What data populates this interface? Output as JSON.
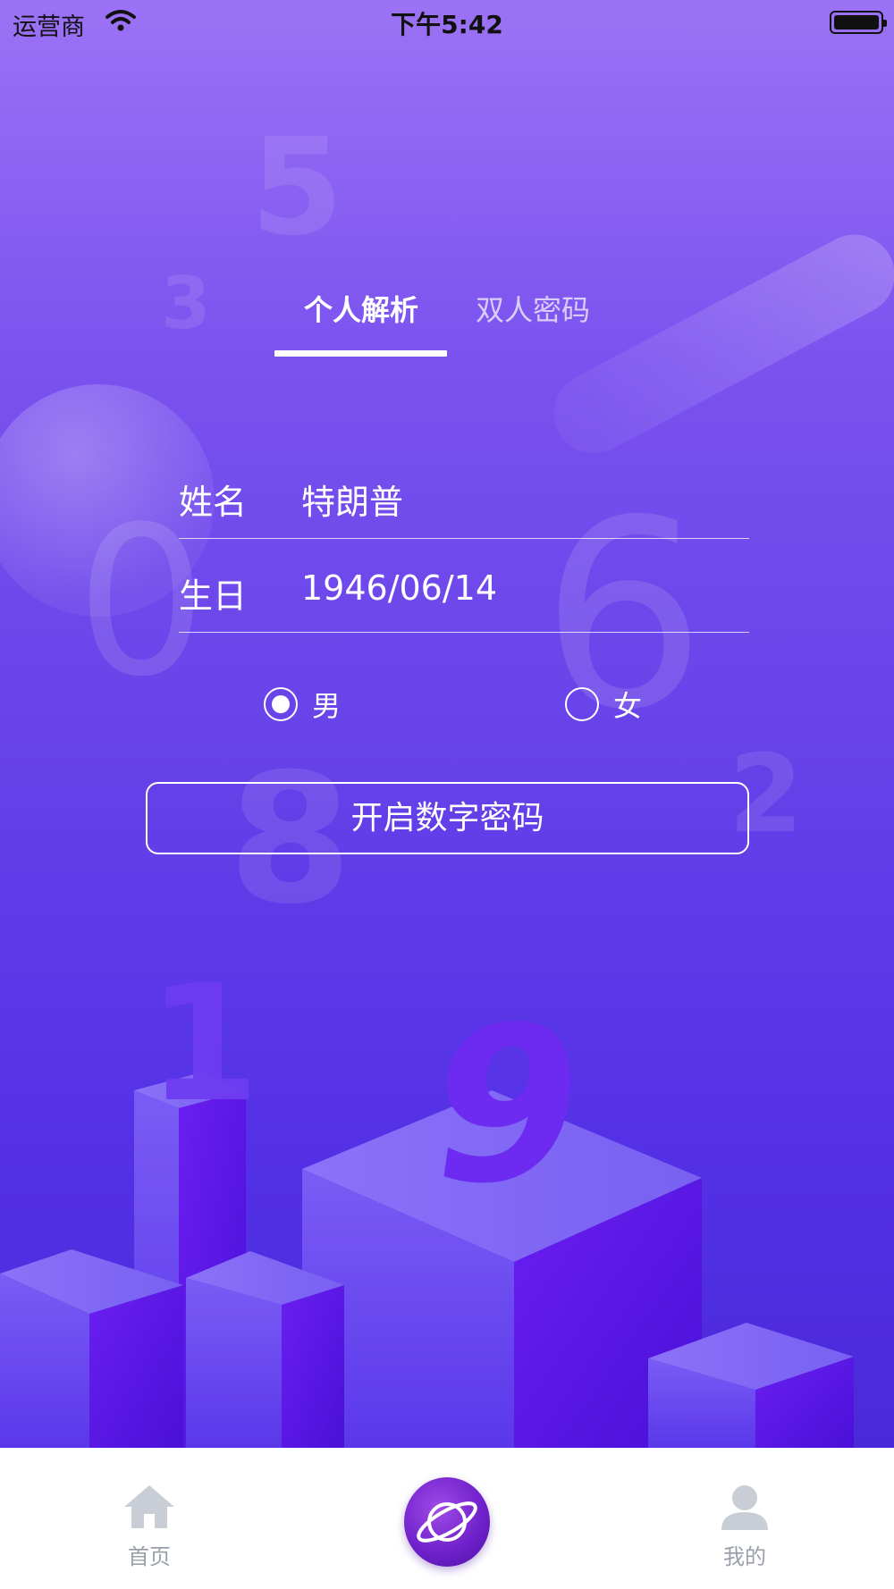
{
  "status_bar": {
    "carrier": "运营商",
    "time": "下午5:42"
  },
  "decor_digits": {
    "d5": "5",
    "d3": "3",
    "d0": "0",
    "d6": "6",
    "d8": "8",
    "d2": "2"
  },
  "tabs": [
    {
      "label": "个人解析",
      "active": true
    },
    {
      "label": "双人密码",
      "active": false
    }
  ],
  "form": {
    "name_label": "姓名",
    "name_value": "特朗普",
    "birthday_label": "生日",
    "birthday_value": "1946/06/14"
  },
  "gender": {
    "male_label": "男",
    "female_label": "女",
    "selected": "male"
  },
  "start_button": "开启数字密码",
  "illustration": {
    "digit_1": "1",
    "digit_9": "9"
  },
  "tab_bar": {
    "home_label": "首页",
    "center_icon": "planet-icon",
    "mine_label": "我的"
  },
  "colors": {
    "accent": "#6a44ee",
    "tab_inactive": "#9aa0ab"
  }
}
